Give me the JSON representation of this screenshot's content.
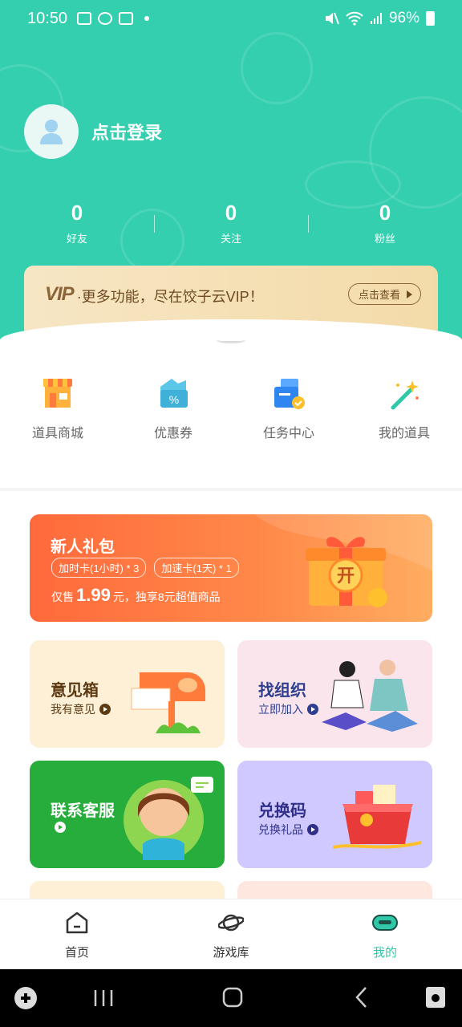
{
  "status_bar": {
    "time": "10:50",
    "battery": "96%"
  },
  "colors": {
    "primary": "#33cfae",
    "active_tab": "#2fc8a8",
    "vip_bg": "#f3dba9",
    "gift_orange": "#ff6a3b"
  },
  "profile": {
    "login_label": "点击登录"
  },
  "stats": [
    {
      "value": "0",
      "label": "好友"
    },
    {
      "value": "0",
      "label": "关注"
    },
    {
      "value": "0",
      "label": "粉丝"
    }
  ],
  "vip": {
    "logo": "VIP",
    "text": "·更多功能，尽在饺子云VIP！",
    "button": "点击查看"
  },
  "quick_links": [
    {
      "label": "道具商城",
      "icon": "shop-icon"
    },
    {
      "label": "优惠券",
      "icon": "coupon-icon"
    },
    {
      "label": "任务中心",
      "icon": "task-icon"
    },
    {
      "label": "我的道具",
      "icon": "magic-wand-icon"
    }
  ],
  "gift": {
    "title": "新人礼包",
    "tag1": "加时卡(1小时) * 3",
    "tag2": "加速卡(1天) * 1",
    "price_prefix": "仅售",
    "price": "1.99",
    "price_suffix": "元，独享8元超值商品",
    "box_text": "开"
  },
  "cards": [
    {
      "title": "意见箱",
      "subtitle": "我有意见"
    },
    {
      "title": "找组织",
      "subtitle": "立即加入"
    },
    {
      "title": "联系客服",
      "subtitle": ""
    },
    {
      "title": "兑换码",
      "subtitle": "兑换礼品"
    }
  ],
  "tabs": [
    {
      "label": "首页",
      "icon": "home-icon"
    },
    {
      "label": "游戏库",
      "icon": "planet-icon"
    },
    {
      "label": "我的",
      "icon": "vr-headset-icon"
    }
  ]
}
